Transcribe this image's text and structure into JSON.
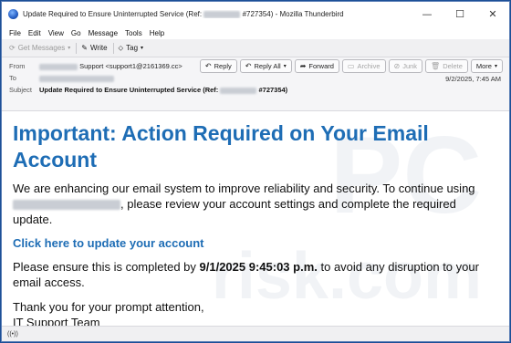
{
  "window": {
    "title_prefix": "Update Required to Ensure Uninterrupted Service (Ref:",
    "title_suffix": "#727354) - Mozilla Thunderbird",
    "minimize": "—",
    "maximize": "☐",
    "close": "✕"
  },
  "menu": [
    "File",
    "Edit",
    "View",
    "Go",
    "Message",
    "Tools",
    "Help"
  ],
  "toolbar": {
    "get_messages": "Get Messages",
    "write": "Write",
    "tag": "Tag"
  },
  "header": {
    "from_label": "From",
    "from_value": "Support <support1@2161369.cc>",
    "to_label": "To",
    "subject_label": "Subject",
    "subject_prefix": "Update Required to Ensure Uninterrupted Service (Ref:",
    "subject_suffix": "#727354)",
    "date": "9/2/2025, 7:45 AM",
    "buttons": {
      "reply": "Reply",
      "reply_all": "Reply All",
      "forward": "Forward",
      "archive": "Archive",
      "junk": "Junk",
      "delete": "Delete",
      "more": "More"
    }
  },
  "body": {
    "heading": "Important: Action Required on Your Email Account",
    "para1_a": "We are enhancing our email system to improve reliability and security. To continue using",
    "para1_b": ", please review your account settings and complete the required update.",
    "link": "Click here to update your account",
    "para2_a": "Please ensure this is completed by",
    "para2_date": "9/1/2025 9:45:03 p.m.",
    "para2_b": "to avoid any disruption to your email access.",
    "closing_1": "Thank you for your prompt attention,",
    "closing_2": "IT Support Team"
  },
  "watermark": {
    "line1": "PC",
    "line2": "risk.com"
  },
  "statusbar": {
    "icon": "((•))"
  }
}
